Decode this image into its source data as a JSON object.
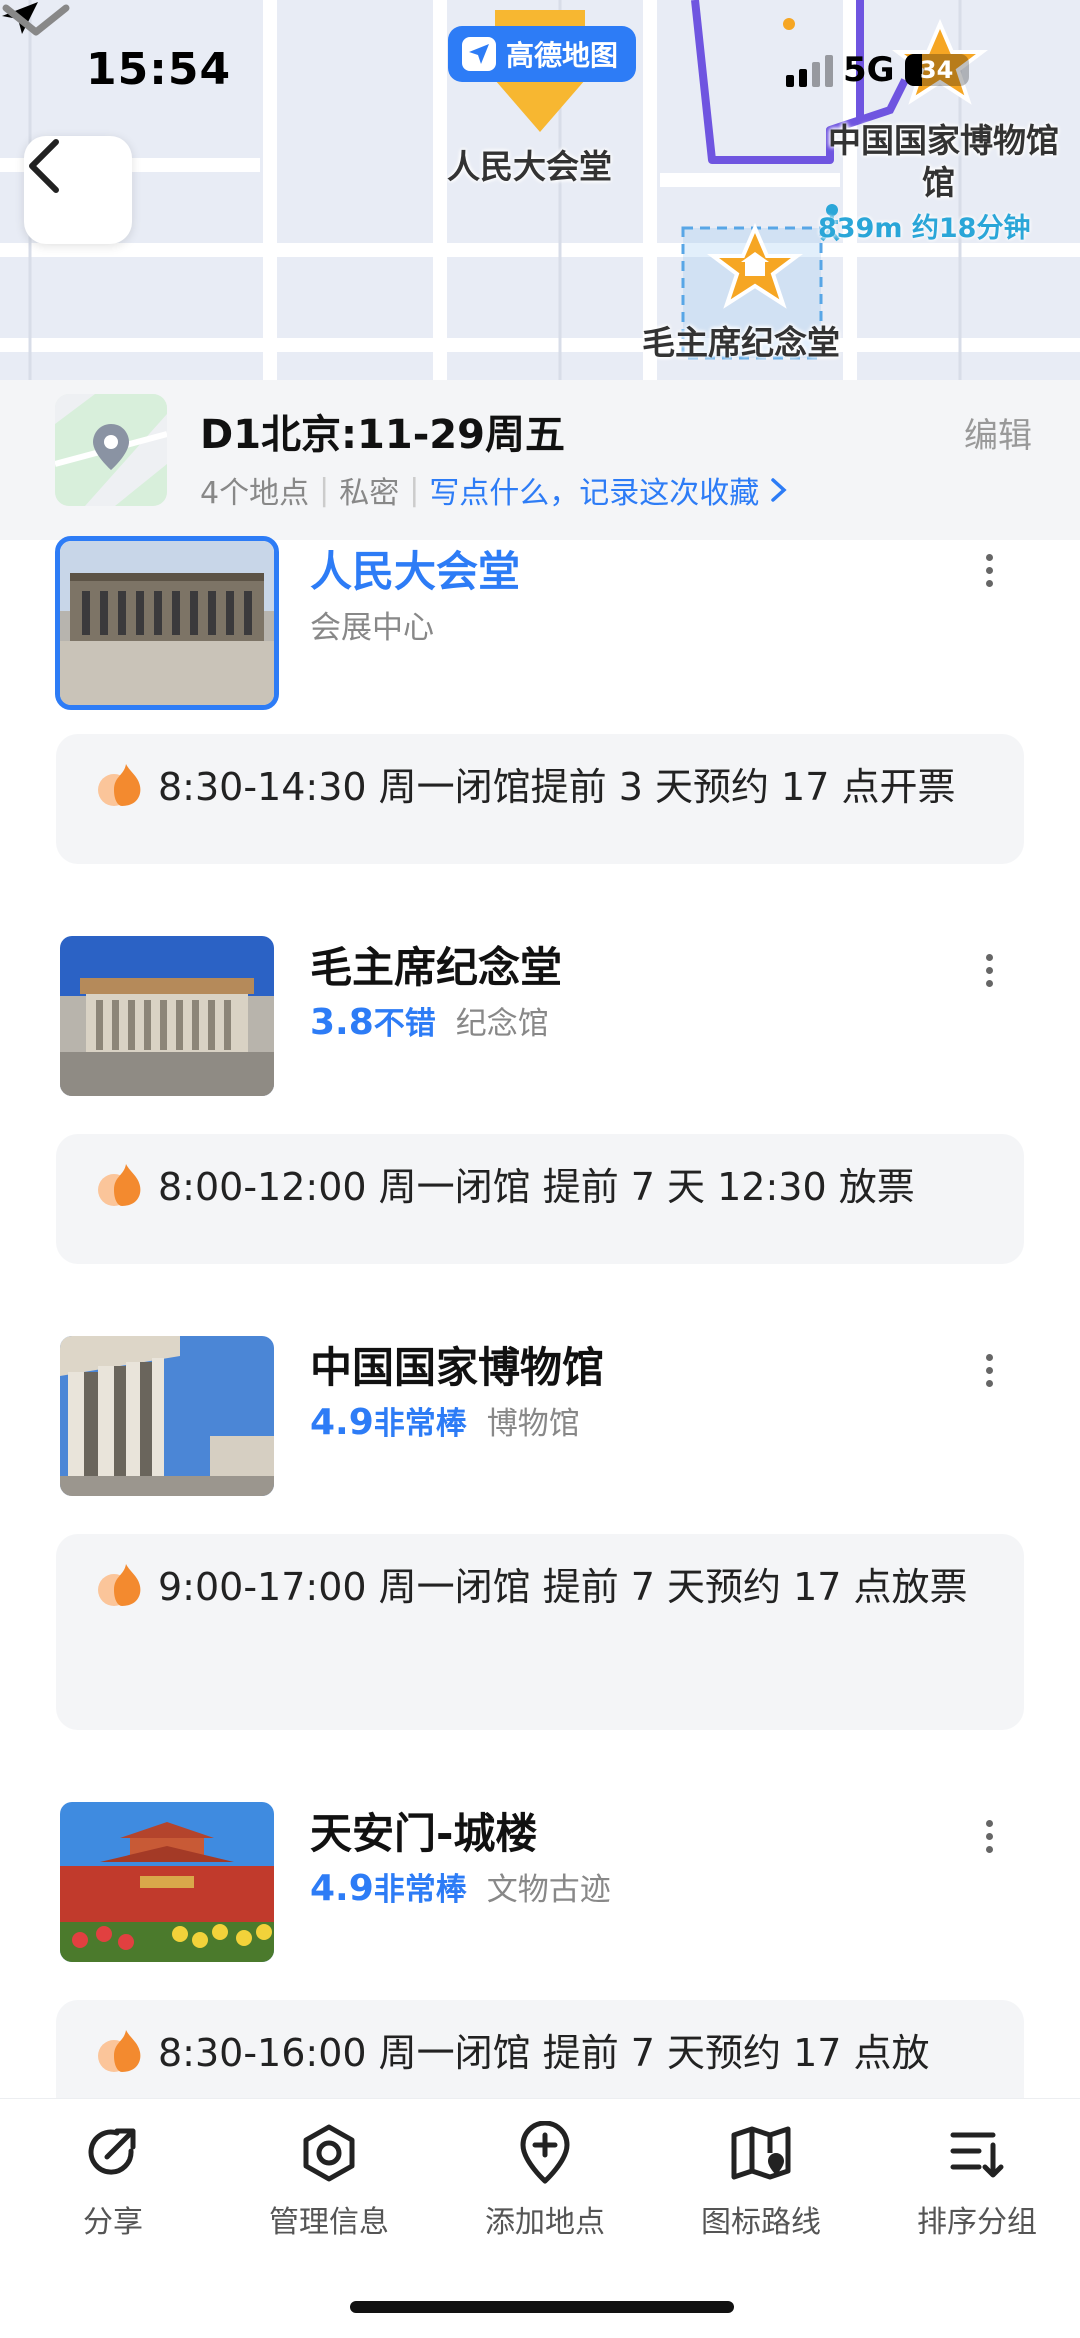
{
  "status_bar": {
    "time": "15:54",
    "network": "5G",
    "battery": "34"
  },
  "map": {
    "app_badge": "高德地图",
    "labels": {
      "great_hall": "人民大会堂",
      "national_museum": "中国国家博物馆",
      "national_museum_line2": "馆",
      "mausoleum": "毛主席纪念堂"
    },
    "walk_info": "839m 约18分钟"
  },
  "header": {
    "title": "D1北京:11-29周五",
    "count": "4个地点",
    "privacy": "私密",
    "memo": "写点什么，记录这次收藏",
    "edit": "编辑"
  },
  "places": [
    {
      "name": "人民大会堂",
      "rating": "",
      "rating_text": "",
      "category": "会展中心",
      "note": "8:30-14:30 周一闭馆提前 3 天预约 17 点开票"
    },
    {
      "name": "毛主席纪念堂",
      "rating": "3.8",
      "rating_text": "不错",
      "category": "纪念馆",
      "note": "8:00-12:00 周一闭馆 提前 7 天 12:30 放票"
    },
    {
      "name": "中国国家博物馆",
      "rating": "4.9",
      "rating_text": "非常棒",
      "category": "博物馆",
      "note": "9:00-17:00 周一闭馆 提前 7 天预约 17 点放票"
    },
    {
      "name": "天安门-城楼",
      "rating": "4.9",
      "rating_text": "非常棒",
      "category": "文物古迹",
      "note": "8:30-16:00 周一闭馆 提前 7 天预约 17 点放"
    }
  ],
  "toolbar": [
    {
      "label": "分享",
      "icon": "share-icon"
    },
    {
      "label": "管理信息",
      "icon": "manage-info-icon"
    },
    {
      "label": "添加地点",
      "icon": "add-location-icon"
    },
    {
      "label": "图标路线",
      "icon": "map-route-icon"
    },
    {
      "label": "排序分组",
      "icon": "sort-group-icon"
    }
  ],
  "colors": {
    "accent": "#2d7cf6",
    "route": "#6f55e0",
    "marker": "#f6a623"
  }
}
